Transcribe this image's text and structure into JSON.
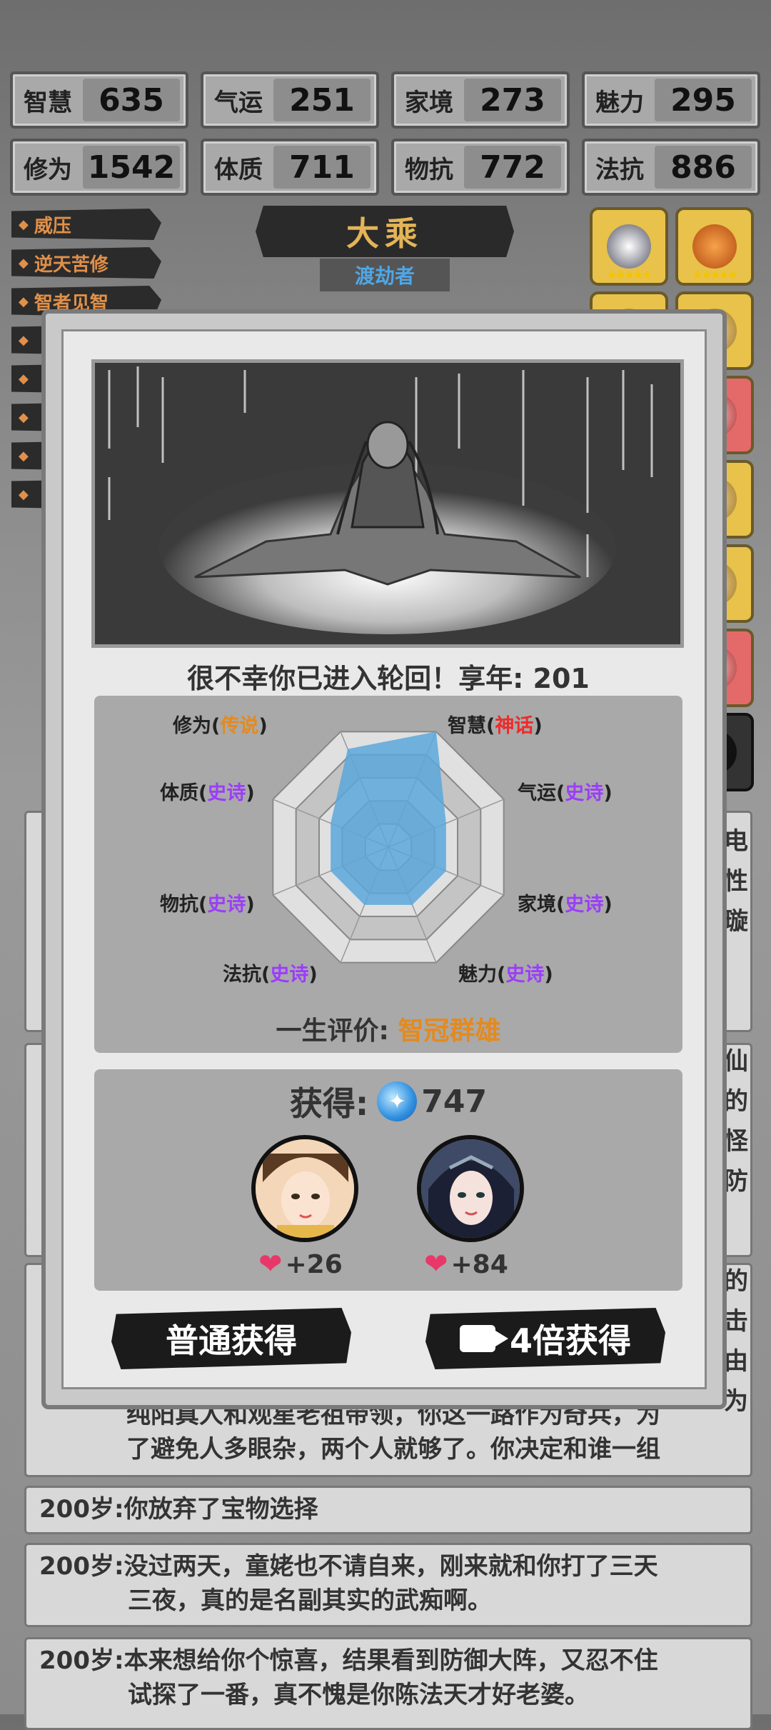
{
  "stats": [
    {
      "label": "智慧",
      "value": "635"
    },
    {
      "label": "气运",
      "value": "251"
    },
    {
      "label": "家境",
      "value": "273"
    },
    {
      "label": "魅力",
      "value": "295"
    },
    {
      "label": "修为",
      "value": "1542"
    },
    {
      "label": "体质",
      "value": "711"
    },
    {
      "label": "物抗",
      "value": "772"
    },
    {
      "label": "法抗",
      "value": "886"
    }
  ],
  "tags": [
    "威压",
    "逆天苦修",
    "智者见智"
  ],
  "realm": {
    "title": "大乘",
    "subtitle": "渡劫者"
  },
  "log_entries": [
    {
      "lines": [
        "纯阳真人和观星老祖带领，你这一路作为奇兵，为",
        "了避免人多眼杂，两个人就够了。你决定和谁一组"
      ]
    },
    {
      "age": "200岁:",
      "text": "你放弃了宝物选择"
    },
    {
      "age": "200岁:",
      "text": "没过两天，童姥也不请自来，刚来就和你打了三天",
      "text2": "三夜，真的是名副其实的武痴啊。"
    },
    {
      "age": "200岁:",
      "text": "本来想给你个惊喜，结果看到防御大阵，又忍不住",
      "text2": "试探了一番，真不愧是你陈法天才好老婆。"
    }
  ],
  "side_chars": [
    "电",
    "性",
    "璇",
    "仙",
    "的",
    "怪",
    "防",
    "的",
    "击",
    "由",
    "为"
  ],
  "modal": {
    "death_text": "很不幸你已进入轮回！享年: 201",
    "radar": {
      "axes": [
        {
          "name": "修为",
          "rank": "传说",
          "rank_color": "#e48a1e",
          "value": 0.85
        },
        {
          "name": "智慧",
          "rank": "神话",
          "rank_color": "#ee2a2a",
          "value": 1.0
        },
        {
          "name": "气运",
          "rank": "史诗",
          "rank_color": "#9b3dfa",
          "value": 0.5
        },
        {
          "name": "家境",
          "rank": "史诗",
          "rank_color": "#9b3dfa",
          "value": 0.5
        },
        {
          "name": "魅力",
          "rank": "史诗",
          "rank_color": "#9b3dfa",
          "value": 0.5
        },
        {
          "name": "法抗",
          "rank": "史诗",
          "rank_color": "#9b3dfa",
          "value": 0.5
        },
        {
          "name": "物抗",
          "rank": "史诗",
          "rank_color": "#9b3dfa",
          "value": 0.5
        },
        {
          "name": "体质",
          "rank": "史诗",
          "rank_color": "#9b3dfa",
          "value": 0.5
        }
      ],
      "fill_color": "#5aa7dc"
    },
    "evaluation_label": "一生评价:",
    "evaluation_value": "智冠群雄",
    "gain_label": "获得:",
    "gain_value": "747",
    "companions": [
      {
        "delta": "+26"
      },
      {
        "delta": "+84"
      }
    ],
    "btn_normal": "普通获得",
    "btn_video": "4倍获得"
  }
}
